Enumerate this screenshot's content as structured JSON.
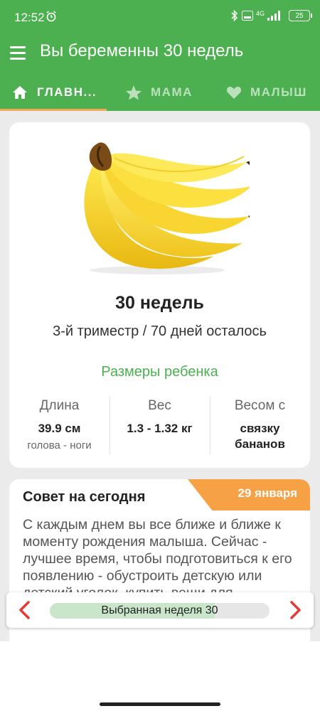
{
  "status": {
    "time": "12:52",
    "network": "4G",
    "battery": "25"
  },
  "header": {
    "title": "Вы беременны 30 недель"
  },
  "tabs": [
    {
      "label": "ГЛАВН...",
      "icon": "home-icon",
      "active": true
    },
    {
      "label": "МАМА",
      "icon": "star-icon",
      "active": false
    },
    {
      "label": "МАЛЫШ",
      "icon": "heart-icon",
      "active": false
    }
  ],
  "week_card": {
    "image": "banana-bunch",
    "title": "30 недель",
    "subtitle": "3-й триместр / 70 дней осталось",
    "size_heading": "Размеры ребенка",
    "stats": [
      {
        "label": "Длина",
        "value": "39.9 см",
        "note": "голова - ноги"
      },
      {
        "label": "Вес",
        "value": "1.3 - 1.32 кг"
      },
      {
        "label": "Весом с",
        "value": "связку бананов"
      }
    ]
  },
  "tip": {
    "title": "Совет на сегодня",
    "date": "29 января",
    "body": "С каждым днем вы все ближе и ближе к моменту рождения малыша. Сейчас - лучшее время, чтобы подготовиться к его появлению - обустроить детскую или детский уголок, купить вещи для"
  },
  "week_selector": {
    "label": "Выбранная неделя 30",
    "progress": 0.75
  },
  "colors": {
    "primary": "#4caf50",
    "accent": "#f7a146",
    "indicator": "#f5a85d",
    "arrow": "#e53935"
  }
}
